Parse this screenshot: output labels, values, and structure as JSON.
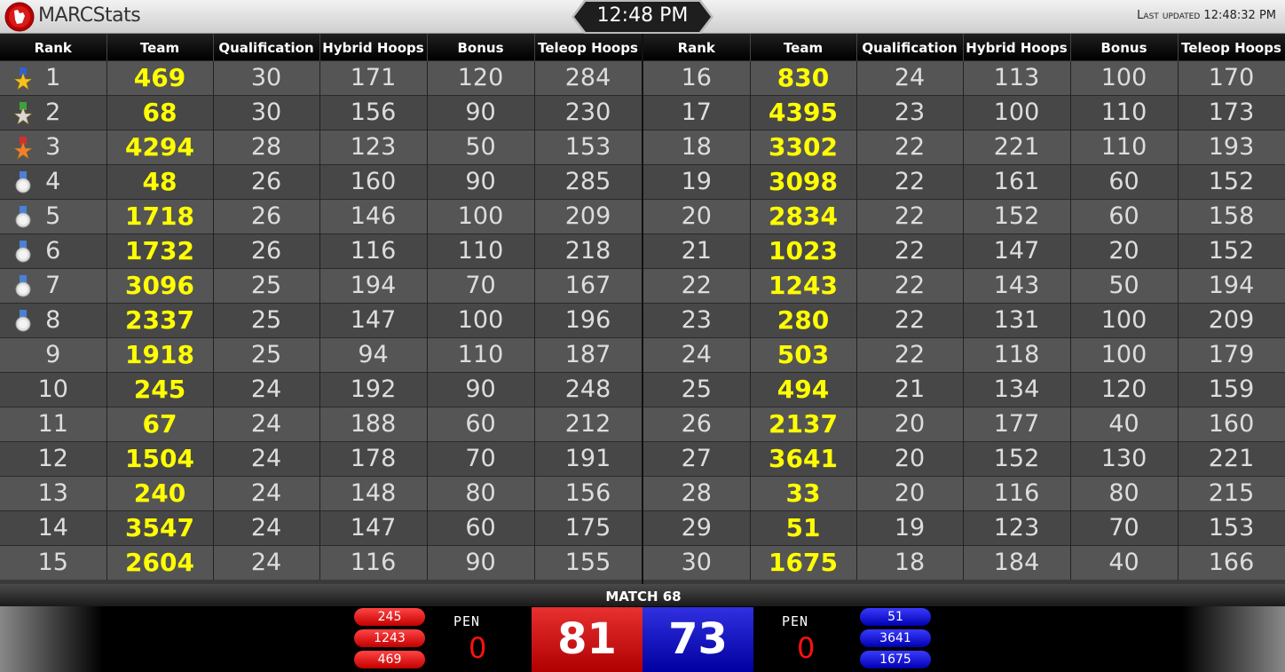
{
  "header": {
    "app_title": "MARCStats",
    "clock": "12:48 PM",
    "last_updated_label": "Last updated",
    "last_updated_value": "12:48:32 PM"
  },
  "columns": [
    "Rank",
    "Team",
    "Qualification",
    "Hybrid Hoops",
    "Bonus",
    "Teleop Hoops"
  ],
  "left_rows": [
    {
      "rank": "1",
      "team": "469",
      "qual": "30",
      "hybrid": "171",
      "bonus": "120",
      "teleop": "284",
      "medal": "gold-star"
    },
    {
      "rank": "2",
      "team": "68",
      "qual": "30",
      "hybrid": "156",
      "bonus": "90",
      "teleop": "230",
      "medal": "silver-star"
    },
    {
      "rank": "3",
      "team": "4294",
      "qual": "28",
      "hybrid": "123",
      "bonus": "50",
      "teleop": "153",
      "medal": "bronze-star"
    },
    {
      "rank": "4",
      "team": "48",
      "qual": "26",
      "hybrid": "160",
      "bonus": "90",
      "teleop": "285",
      "medal": "blue-medal"
    },
    {
      "rank": "5",
      "team": "1718",
      "qual": "26",
      "hybrid": "146",
      "bonus": "100",
      "teleop": "209",
      "medal": "blue-medal"
    },
    {
      "rank": "6",
      "team": "1732",
      "qual": "26",
      "hybrid": "116",
      "bonus": "110",
      "teleop": "218",
      "medal": "blue-medal"
    },
    {
      "rank": "7",
      "team": "3096",
      "qual": "25",
      "hybrid": "194",
      "bonus": "70",
      "teleop": "167",
      "medal": "blue-medal"
    },
    {
      "rank": "8",
      "team": "2337",
      "qual": "25",
      "hybrid": "147",
      "bonus": "100",
      "teleop": "196",
      "medal": "blue-medal"
    },
    {
      "rank": "9",
      "team": "1918",
      "qual": "25",
      "hybrid": "94",
      "bonus": "110",
      "teleop": "187",
      "medal": ""
    },
    {
      "rank": "10",
      "team": "245",
      "qual": "24",
      "hybrid": "192",
      "bonus": "90",
      "teleop": "248",
      "medal": ""
    },
    {
      "rank": "11",
      "team": "67",
      "qual": "24",
      "hybrid": "188",
      "bonus": "60",
      "teleop": "212",
      "medal": ""
    },
    {
      "rank": "12",
      "team": "1504",
      "qual": "24",
      "hybrid": "178",
      "bonus": "70",
      "teleop": "191",
      "medal": ""
    },
    {
      "rank": "13",
      "team": "240",
      "qual": "24",
      "hybrid": "148",
      "bonus": "80",
      "teleop": "156",
      "medal": ""
    },
    {
      "rank": "14",
      "team": "3547",
      "qual": "24",
      "hybrid": "147",
      "bonus": "60",
      "teleop": "175",
      "medal": ""
    },
    {
      "rank": "15",
      "team": "2604",
      "qual": "24",
      "hybrid": "116",
      "bonus": "90",
      "teleop": "155",
      "medal": ""
    }
  ],
  "right_rows": [
    {
      "rank": "16",
      "team": "830",
      "qual": "24",
      "hybrid": "113",
      "bonus": "100",
      "teleop": "170"
    },
    {
      "rank": "17",
      "team": "4395",
      "qual": "23",
      "hybrid": "100",
      "bonus": "110",
      "teleop": "173"
    },
    {
      "rank": "18",
      "team": "3302",
      "qual": "22",
      "hybrid": "221",
      "bonus": "110",
      "teleop": "193"
    },
    {
      "rank": "19",
      "team": "3098",
      "qual": "22",
      "hybrid": "161",
      "bonus": "60",
      "teleop": "152"
    },
    {
      "rank": "20",
      "team": "2834",
      "qual": "22",
      "hybrid": "152",
      "bonus": "60",
      "teleop": "158"
    },
    {
      "rank": "21",
      "team": "1023",
      "qual": "22",
      "hybrid": "147",
      "bonus": "20",
      "teleop": "152"
    },
    {
      "rank": "22",
      "team": "1243",
      "qual": "22",
      "hybrid": "143",
      "bonus": "50",
      "teleop": "194"
    },
    {
      "rank": "23",
      "team": "280",
      "qual": "22",
      "hybrid": "131",
      "bonus": "100",
      "teleop": "209"
    },
    {
      "rank": "24",
      "team": "503",
      "qual": "22",
      "hybrid": "118",
      "bonus": "100",
      "teleop": "179"
    },
    {
      "rank": "25",
      "team": "494",
      "qual": "21",
      "hybrid": "134",
      "bonus": "120",
      "teleop": "159"
    },
    {
      "rank": "26",
      "team": "2137",
      "qual": "20",
      "hybrid": "177",
      "bonus": "40",
      "teleop": "160"
    },
    {
      "rank": "27",
      "team": "3641",
      "qual": "20",
      "hybrid": "152",
      "bonus": "130",
      "teleop": "221"
    },
    {
      "rank": "28",
      "team": "33",
      "qual": "20",
      "hybrid": "116",
      "bonus": "80",
      "teleop": "215"
    },
    {
      "rank": "29",
      "team": "51",
      "qual": "19",
      "hybrid": "123",
      "bonus": "70",
      "teleop": "153"
    },
    {
      "rank": "30",
      "team": "1675",
      "qual": "18",
      "hybrid": "184",
      "bonus": "40",
      "teleop": "166"
    }
  ],
  "match": {
    "label": "MATCH 68",
    "red_teams": [
      "245",
      "1243",
      "469"
    ],
    "blue_teams": [
      "51",
      "3641",
      "1675"
    ],
    "pen_label": "PEN",
    "red_pen": "0",
    "blue_pen": "0",
    "red_score": "81",
    "blue_score": "73"
  },
  "colors": {
    "team_text": "#ffff00",
    "red_alliance": "#c40000",
    "blue_alliance": "#0000b0"
  }
}
